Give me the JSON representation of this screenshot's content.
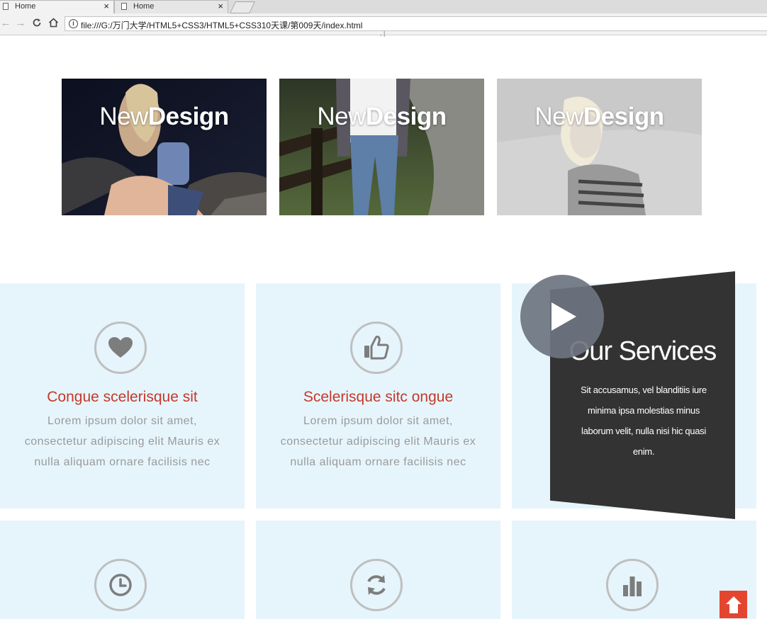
{
  "browser": {
    "tabs": [
      {
        "label": "Home",
        "close": "×"
      },
      {
        "label": "Home",
        "close": "×"
      }
    ],
    "address": {
      "info_glyph": "i",
      "url": "file:///G:/万门大学/HTML5+CSS3/HTML5+CSS310天课/第009天/index.html"
    },
    "icons": [
      "back-icon",
      "forward-icon",
      "reload-icon",
      "home-icon",
      "info-icon",
      "document-icon"
    ]
  },
  "gallery": {
    "items": [
      {
        "title_light": "New",
        "title_bold": "Design"
      },
      {
        "title_light": "New",
        "title_bold": "Design"
      },
      {
        "title_light": "New",
        "title_bold": "Design"
      }
    ]
  },
  "features": [
    {
      "icon": "heart-icon",
      "title": "Congue scelerisque sit",
      "text_lines": [
        "Lorem ipsum dolor sit amet,",
        "consectetur adipiscing elit Mauris ex",
        "nulla aliquam ornare facilisis nec"
      ]
    },
    {
      "icon": "thumbs-up-icon",
      "title": "Scelerisque sitc ongue",
      "text_lines": [
        "Lorem ipsum dolor sit amet,",
        "consectetur adipiscing elit Mauris ex",
        "nulla aliquam ornare facilisis nec"
      ]
    }
  ],
  "services": {
    "title": "Our Services",
    "text_lines": [
      "Sit accusamus, vel blanditiis iure",
      "minima ipsa molestias minus",
      "laborum velit, nulla nisi hic quasi",
      "enim."
    ]
  },
  "bottom_icons": [
    "clock-icon",
    "refresh-icon",
    "bar-chart-icon"
  ],
  "colors": {
    "card_bg": "#e6f5fc",
    "title_red": "#c3392b",
    "services_bg": "#333333",
    "to_top": "#e4452f"
  }
}
